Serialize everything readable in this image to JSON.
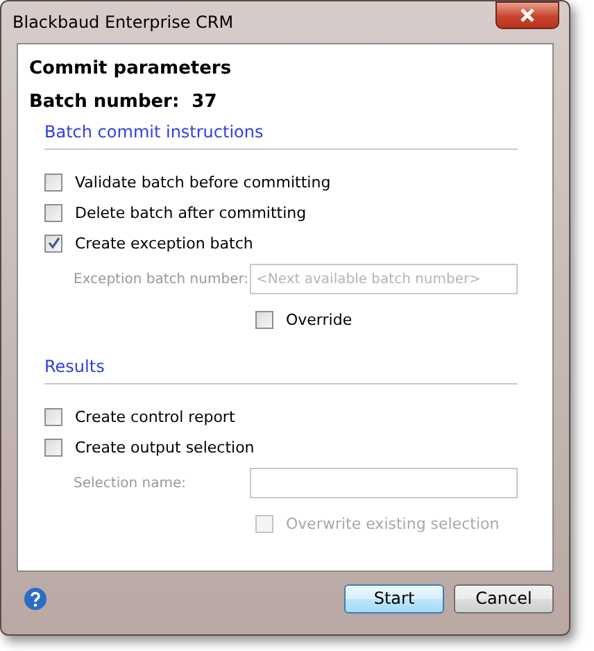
{
  "window": {
    "title": "Blackbaud Enterprise CRM"
  },
  "heading": "Commit parameters",
  "batch": {
    "label": "Batch number:",
    "value": "37"
  },
  "sections": [
    {
      "title": "Batch commit instructions",
      "items": [
        {
          "kind": "checkbox",
          "label": "Validate batch before committing",
          "checked": false
        },
        {
          "kind": "checkbox",
          "label": "Delete batch after committing",
          "checked": false
        },
        {
          "kind": "checkbox",
          "label": "Create exception batch",
          "checked": true
        },
        {
          "kind": "field",
          "label": "Exception batch number:",
          "placeholder": "<Next available batch number>"
        },
        {
          "kind": "option",
          "label": "Override",
          "checked": false,
          "disabled": false
        }
      ]
    },
    {
      "title": "Results",
      "items": [
        {
          "kind": "checkbox",
          "label": "Create control report",
          "checked": false
        },
        {
          "kind": "checkbox",
          "label": "Create output selection",
          "checked": false
        },
        {
          "kind": "field",
          "label": "Selection name:"
        },
        {
          "kind": "option",
          "label": "Overwrite existing selection",
          "checked": false,
          "disabled": true
        }
      ]
    }
  ],
  "buttons": [
    {
      "label": "Start",
      "default": true
    },
    {
      "label": "Cancel",
      "default": false
    }
  ]
}
